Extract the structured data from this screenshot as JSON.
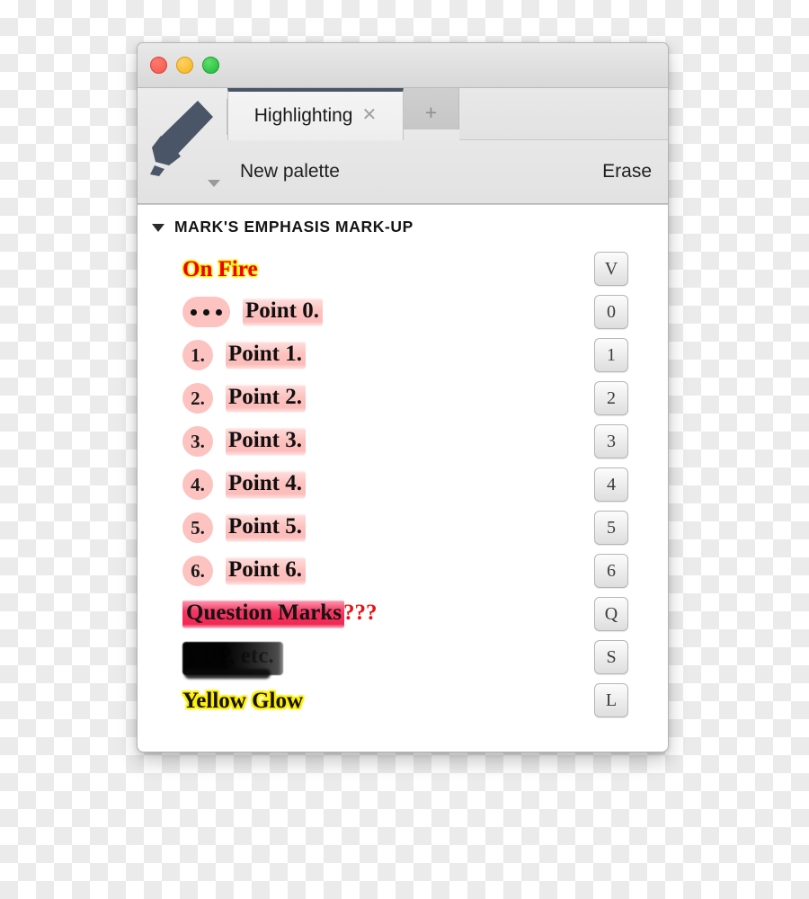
{
  "window": {
    "traffic_lights": [
      "close",
      "minimize",
      "maximize"
    ]
  },
  "tabbar": {
    "active_tab_label": "Highlighting",
    "close_glyph": "✕",
    "new_tab_glyph": "+"
  },
  "toolbar": {
    "marker_icon": "highlighter-marker-icon",
    "dropdown_glyph": "▼",
    "palette_label": "New palette",
    "erase_label": "Erase"
  },
  "section": {
    "disclosure_glyph": "▼",
    "title": "MARK'S EMPHASIS MARK-UP"
  },
  "colors": {
    "tab_accent": "#4a5568",
    "pink_highlight": "#fcbab7",
    "crimson_highlight": "#f42d5a",
    "yellow_glow": "#ffee00",
    "fire_red": "#ee0000",
    "blackout": "#000000"
  },
  "rows": [
    {
      "style": "onfire",
      "label": "On Fire",
      "key": "V"
    },
    {
      "style": "pink-bullet",
      "badge": "•••",
      "badge_kind": "dots",
      "label": "Point 0.",
      "key": "0"
    },
    {
      "style": "pink-number",
      "badge": "1.",
      "badge_kind": "text",
      "label": "Point 1.",
      "key": "1"
    },
    {
      "style": "pink-number",
      "badge": "2.",
      "badge_kind": "text",
      "label": "Point 2.",
      "key": "2"
    },
    {
      "style": "pink-number",
      "badge": "3.",
      "badge_kind": "text",
      "label": "Point 3.",
      "key": "3"
    },
    {
      "style": "pink-number",
      "badge": "4.",
      "badge_kind": "text",
      "label": "Point 4.",
      "key": "4"
    },
    {
      "style": "pink-number",
      "badge": "5.",
      "badge_kind": "text",
      "label": "Point 5.",
      "key": "5"
    },
    {
      "style": "pink-number",
      "badge": "6.",
      "badge_kind": "text",
      "label": "Point 6.",
      "key": "6"
    },
    {
      "style": "question",
      "label": "Question Marks",
      "suffix": "???",
      "key": "Q"
    },
    {
      "style": "redacted",
      "label": "FDP, etc.",
      "key": "S"
    },
    {
      "style": "yellowglow",
      "label": "Yellow Glow",
      "key": "L"
    }
  ]
}
